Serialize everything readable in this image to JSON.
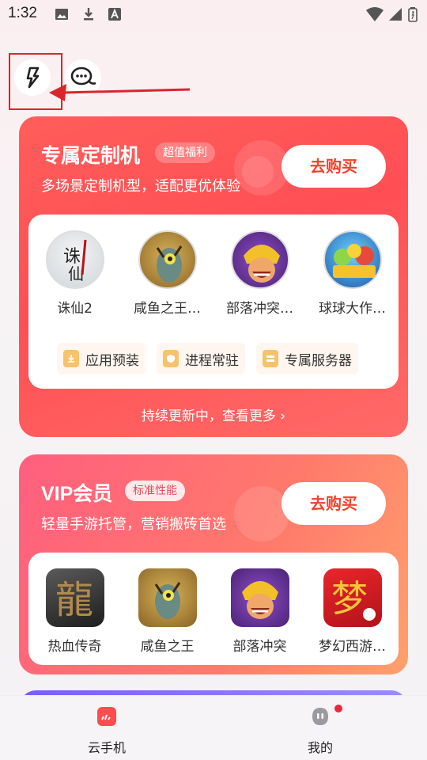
{
  "status_bar": {
    "time": "1:32"
  },
  "custom_card": {
    "title": "专属定制机",
    "badge": "超值福利",
    "subtitle": "多场景定制机型，适配更优体验",
    "buy_label": "去购买",
    "games": [
      {
        "name": "诛仙2"
      },
      {
        "name": "咸鱼之王…"
      },
      {
        "name": "部落冲突…"
      },
      {
        "name": "球球大作…"
      }
    ],
    "features": [
      {
        "label": "应用预装"
      },
      {
        "label": "进程常驻"
      },
      {
        "label": "专属服务器"
      }
    ],
    "more_link": "持续更新中，查看更多 ›"
  },
  "vip_card": {
    "title": "VIP会员",
    "badge": "标准性能",
    "subtitle": "轻量手游托管，营销搬砖首选",
    "buy_label": "去购买",
    "games": [
      {
        "name": "热血传奇"
      },
      {
        "name": "咸鱼之王"
      },
      {
        "name": "部落冲突"
      },
      {
        "name": "梦幻西游…"
      }
    ]
  },
  "bottom_nav": {
    "items": [
      {
        "label": "云手机"
      },
      {
        "label": "我的"
      }
    ]
  }
}
